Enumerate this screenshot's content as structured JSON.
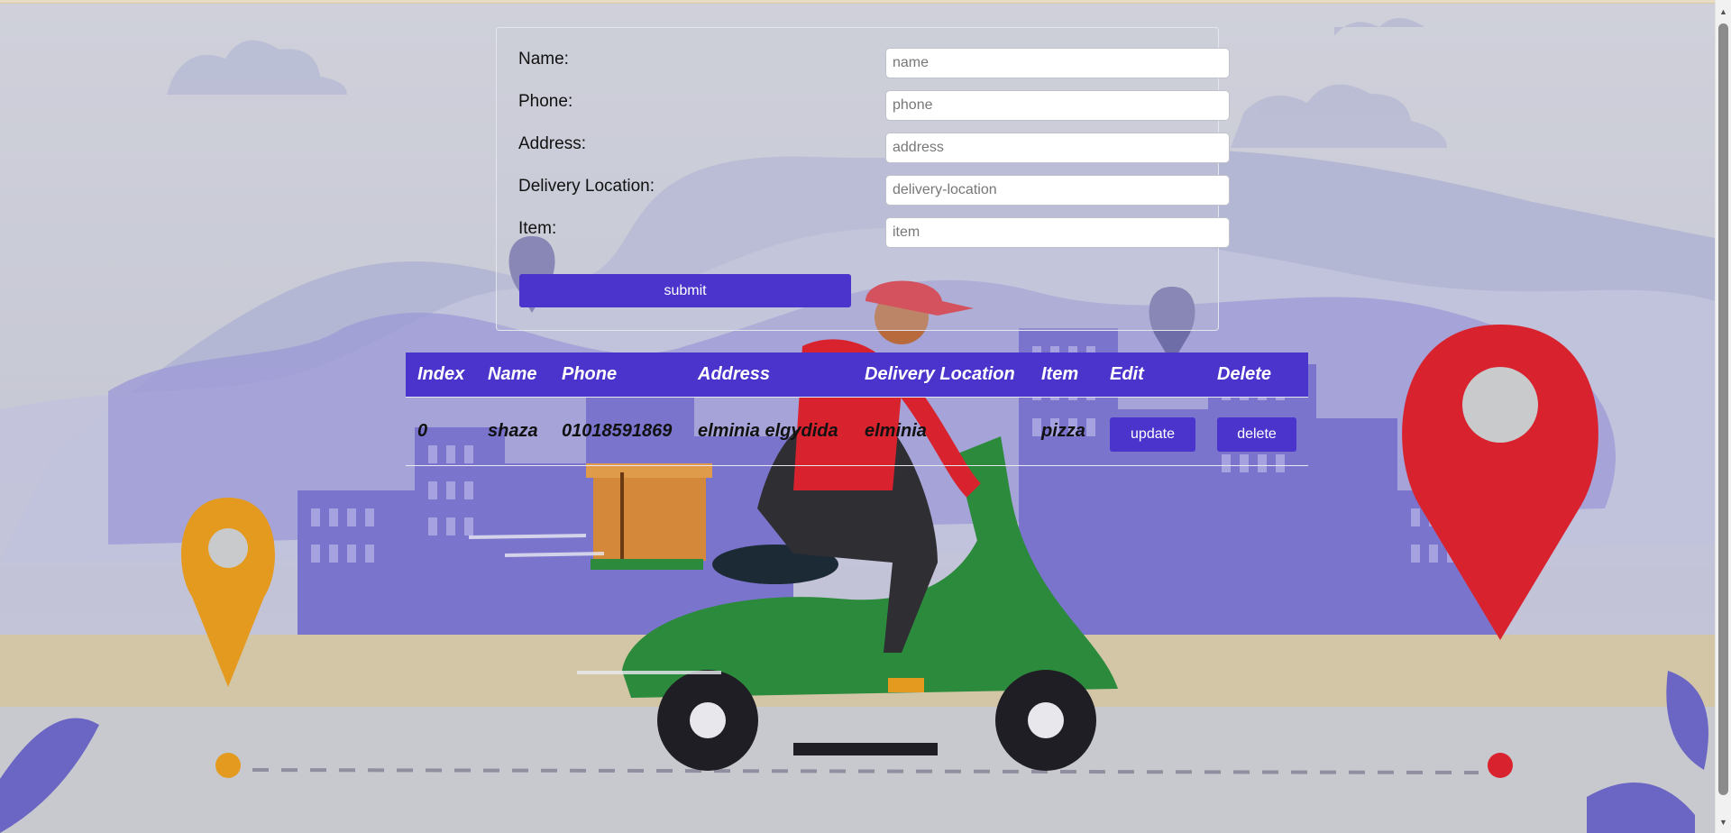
{
  "form": {
    "fields": [
      {
        "label": "Name:",
        "placeholder": "name",
        "value": ""
      },
      {
        "label": "Phone:",
        "placeholder": "phone",
        "value": ""
      },
      {
        "label": "Address:",
        "placeholder": "address",
        "value": ""
      },
      {
        "label": "Delivery Location:",
        "placeholder": "delivery-location",
        "value": ""
      },
      {
        "label": "Item:",
        "placeholder": "item",
        "value": ""
      }
    ],
    "submit_label": "submit"
  },
  "table": {
    "headers": [
      "Index",
      "Name",
      "Phone",
      "Address",
      "Delivery Location",
      "Item",
      "Edit",
      "Delete"
    ],
    "rows": [
      {
        "index": "0",
        "name": "shaza",
        "phone": "01018591869",
        "address": "elminia elgydida",
        "delivery_location": "elminia",
        "item": "pizza",
        "update_label": "update",
        "delete_label": "delete"
      }
    ]
  },
  "background": {
    "illustration": "delivery-scooter-city",
    "icons": [
      "map-pin-icon",
      "scooter-rider-icon",
      "city-skyline-icon"
    ]
  },
  "colors": {
    "accent": "#4b34cc",
    "pin_red": "#d8232f",
    "pin_orange": "#e39a1e",
    "scooter_green": "#2c8a3c",
    "buildings": "#6b65c4"
  }
}
